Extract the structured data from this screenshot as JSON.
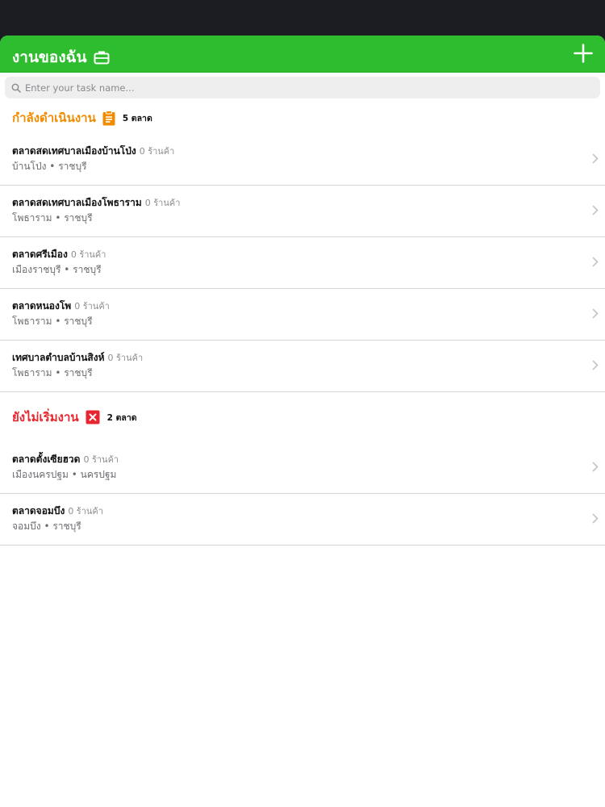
{
  "colors": {
    "nav_green": "#2ebd2e",
    "in_progress_orange": "#f08c00",
    "not_started_red": "#e8262f"
  },
  "navbar": {
    "title": "งานของฉัน",
    "title_icon": "briefcase-icon",
    "add_icon": "plus-icon"
  },
  "search": {
    "placeholder": "Enter your task name...",
    "value": ""
  },
  "sections": [
    {
      "title": "กำลังดำเนินงาน",
      "icon": "clipboard-icon",
      "count": "5 ตลาด",
      "items": [
        {
          "name": "ตลาดสดเทศบาลเมืองบ้านโป่ง",
          "shops": "0 ร้านค้า",
          "location": "บ้านโป่ง • ราชบุรี"
        },
        {
          "name": "ตลาดสดเทศบาลเมืองโพธาราม",
          "shops": "0 ร้านค้า",
          "location": "โพธาราม • ราชบุรี"
        },
        {
          "name": "ตลาดศรีเมือง",
          "shops": "0 ร้านค้า",
          "location": "เมืองราชบุรี • ราชบุรี"
        },
        {
          "name": "ตลาดหนองโพ",
          "shops": "0 ร้านค้า",
          "location": "โพธาราม • ราชบุรี"
        },
        {
          "name": "เทศบาลตำบลบ้านสิงห์",
          "shops": "0 ร้านค้า",
          "location": "โพธาราม • ราชบุรี"
        }
      ]
    },
    {
      "title": "ยังไม่เริ่มงาน",
      "icon": "close-box-icon",
      "count": "2 ตลาด",
      "items": [
        {
          "name": "ตลาดตั้งเซียฮวด",
          "shops": "0 ร้านค้า",
          "location": "เมืองนครปฐม • นครปฐม"
        },
        {
          "name": "ตลาดจอมบึง",
          "shops": "0 ร้านค้า",
          "location": "จอมบึง • ราชบุรี"
        }
      ]
    }
  ]
}
